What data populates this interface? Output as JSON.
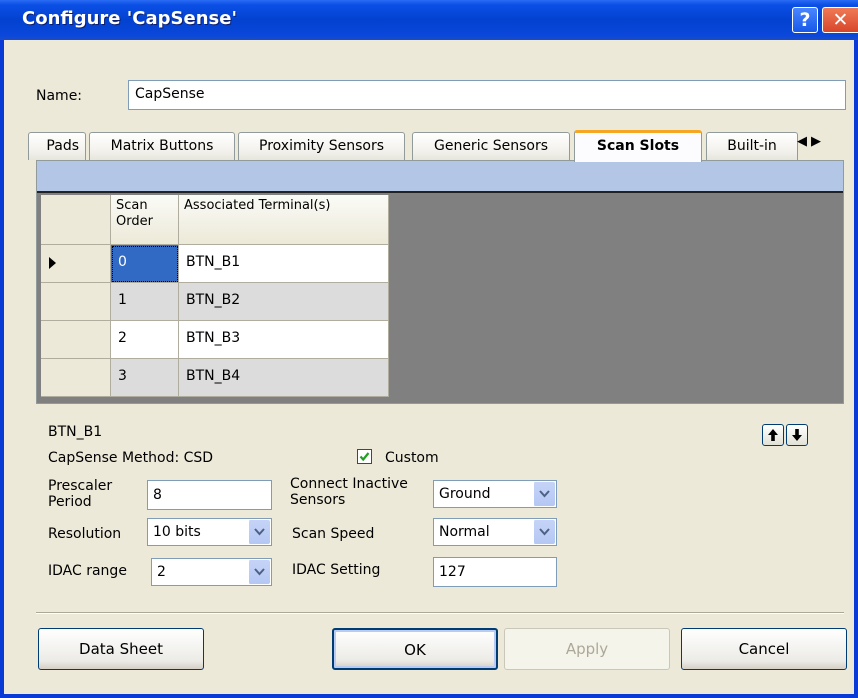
{
  "window": {
    "title": "Configure 'CapSense'",
    "help_glyph": "?",
    "close_glyph": "✕"
  },
  "name": {
    "label": "Name:",
    "value": "CapSense"
  },
  "tabs": [
    {
      "label": "Pads"
    },
    {
      "label": "Matrix Buttons"
    },
    {
      "label": "Proximity Sensors"
    },
    {
      "label": "Generic Sensors"
    },
    {
      "label": "Scan Slots",
      "active": true
    },
    {
      "label": "Built-in"
    }
  ],
  "tab_scroll": {
    "left": "◀",
    "right": "▶"
  },
  "grid": {
    "headers": [
      "Scan Order",
      "Associated Terminal(s)"
    ],
    "rows": [
      {
        "order": "0",
        "terminal": "BTN_B1",
        "selected": true
      },
      {
        "order": "1",
        "terminal": "BTN_B2"
      },
      {
        "order": "2",
        "terminal": "BTN_B3"
      },
      {
        "order": "3",
        "terminal": "BTN_B4"
      }
    ]
  },
  "details": {
    "sensor_name": "BTN_B1",
    "method": "CapSense Method: CSD",
    "custom_label": "Custom",
    "custom_checked": true,
    "prescaler_label": "Prescaler Period",
    "prescaler_value": "8",
    "resolution_label": "Resolution",
    "resolution_value": "10 bits",
    "idac_range_label": "IDAC range",
    "idac_range_value": "2",
    "connect_label": "Connect Inactive Sensors",
    "connect_value": "Ground",
    "scan_speed_label": "Scan Speed",
    "scan_speed_value": "Normal",
    "idac_setting_label": "IDAC Setting",
    "idac_setting_value": "127"
  },
  "buttons": {
    "datasheet": "Data Sheet",
    "ok": "OK",
    "apply": "Apply",
    "cancel": "Cancel"
  }
}
